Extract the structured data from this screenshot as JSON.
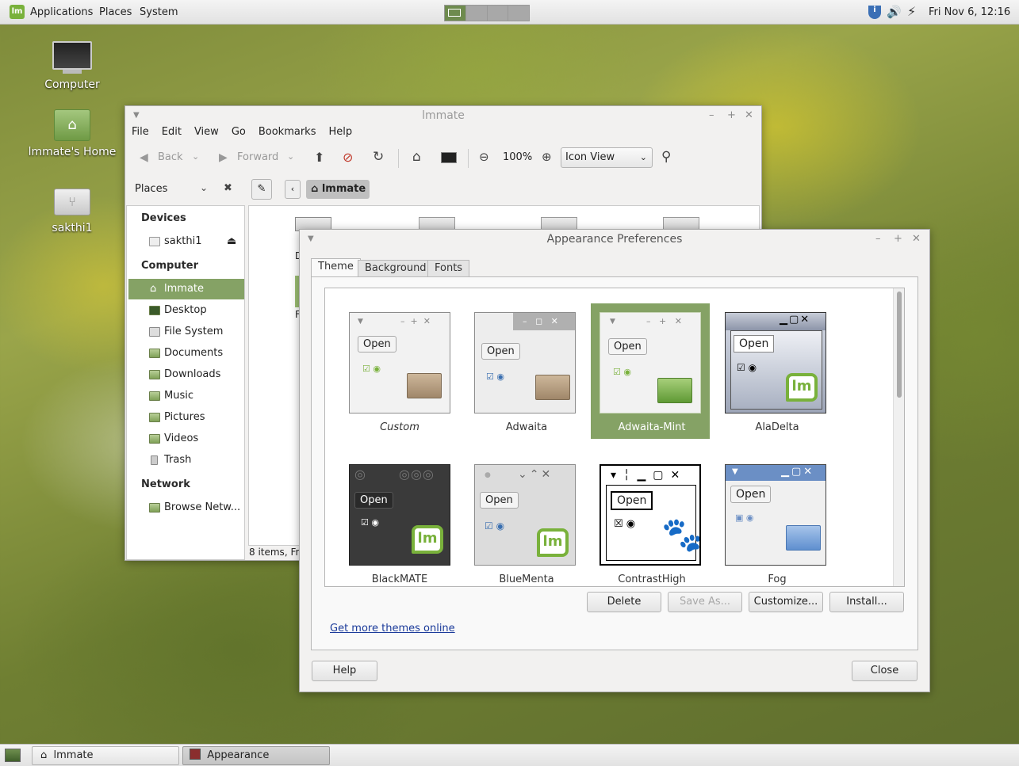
{
  "top_panel": {
    "menus": [
      "Applications",
      "Places",
      "System"
    ],
    "clock": "Fri Nov  6, 12:16"
  },
  "desktop": {
    "icons": [
      "Computer",
      "lmmate's Home",
      "sakthi1"
    ]
  },
  "file_manager": {
    "title": "lmmate",
    "menu": [
      "File",
      "Edit",
      "View",
      "Go",
      "Bookmarks",
      "Help"
    ],
    "toolbar": {
      "back": "Back",
      "forward": "Forward",
      "zoom": "100%",
      "view_mode": "Icon View"
    },
    "places_label": "Places",
    "location": "lmmate",
    "sidebar": {
      "devices_heading": "Devices",
      "device": "sakthi1",
      "computer_heading": "Computer",
      "items": [
        "lmmate",
        "Desktop",
        "File System",
        "Documents",
        "Downloads",
        "Music",
        "Pictures",
        "Videos",
        "Trash"
      ],
      "network_heading": "Network",
      "network_item": "Browse Netw..."
    },
    "status": "8 items, Fr",
    "partial_labels": [
      "D",
      "F"
    ]
  },
  "appearance": {
    "title": "Appearance Preferences",
    "tabs": [
      "Theme",
      "Background",
      "Fonts"
    ],
    "open_label": "Open",
    "themes": [
      "Custom",
      "Adwaita",
      "Adwaita-Mint",
      "AlaDelta",
      "BlackMATE",
      "BlueMenta",
      "ContrastHigh",
      "Fog"
    ],
    "selected_theme": "Adwaita-Mint",
    "buttons": {
      "delete": "Delete",
      "save_as": "Save As...",
      "customize": "Customize...",
      "install": "Install..."
    },
    "link": "Get more themes online",
    "help": "Help",
    "close": "Close"
  },
  "taskbar": [
    "lmmate",
    "Appearance Preferences"
  ]
}
